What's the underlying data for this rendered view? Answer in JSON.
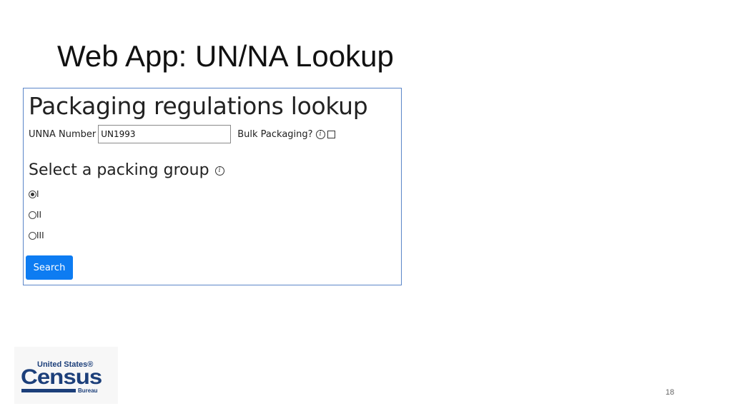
{
  "slide": {
    "title": "Web App: UN/NA Lookup",
    "page_number": "18"
  },
  "app": {
    "heading": "Packaging regulations lookup",
    "unna_label": "UNNA Number",
    "unna_value": "UN1993",
    "bulk_label": "Bulk Packaging?",
    "bulk_checked": false,
    "group_heading": "Select a packing group",
    "packing_groups": [
      {
        "label": "I",
        "selected": true
      },
      {
        "label": "II",
        "selected": false
      },
      {
        "label": "III",
        "selected": false
      }
    ],
    "search_label": "Search",
    "colors": {
      "button": "#0d7cf2",
      "frame_border": "#5b86c8"
    },
    "icons": {
      "info": "info-circle-icon"
    }
  },
  "logo": {
    "top": "United States®",
    "main": "Census",
    "bottom": "Bureau",
    "color": "#1c3f7a"
  }
}
